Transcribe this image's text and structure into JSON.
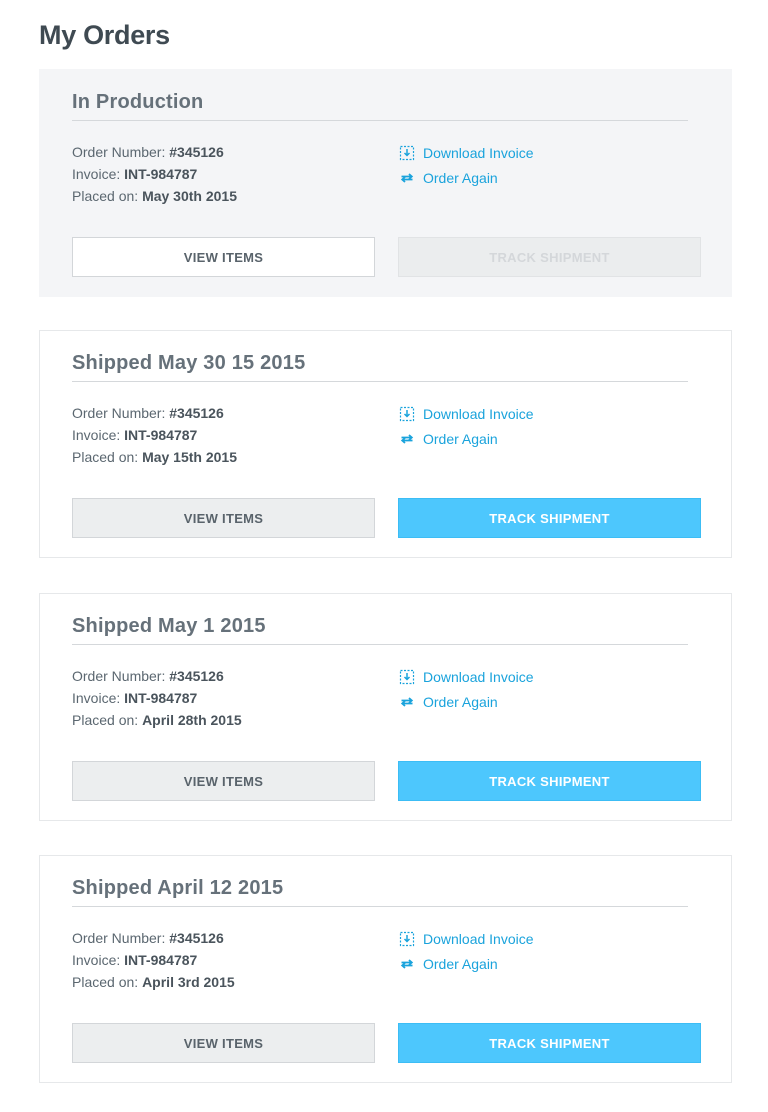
{
  "page": {
    "title": "My Orders"
  },
  "labels": {
    "order_number": "Order Number:",
    "invoice": "Invoice:",
    "placed_on": "Placed on:",
    "download_invoice": "Download Invoice",
    "order_again": "Order Again",
    "view_items": "VIEW ITEMS",
    "track_shipment": "TRACK SHIPMENT"
  },
  "icons": {
    "download": "download-icon",
    "reorder": "refresh-icon"
  },
  "colors": {
    "accent": "#4dc7fd",
    "link": "#1aa3dc",
    "title": "#3f4a52"
  },
  "orders": [
    {
      "status": "In Production",
      "order_number": "#345126",
      "invoice": "INT-984787",
      "placed_on": "May 30th 2015",
      "track_enabled": false
    },
    {
      "status": "Shipped May 30 15 2015",
      "order_number": "#345126",
      "invoice": "INT-984787",
      "placed_on": "May 15th 2015",
      "track_enabled": true
    },
    {
      "status": "Shipped May 1 2015",
      "order_number": "#345126",
      "invoice": "INT-984787",
      "placed_on": "April 28th 2015",
      "track_enabled": true
    },
    {
      "status": "Shipped April 12 2015",
      "order_number": "#345126",
      "invoice": "INT-984787",
      "placed_on": "April 3rd 2015",
      "track_enabled": true
    }
  ]
}
